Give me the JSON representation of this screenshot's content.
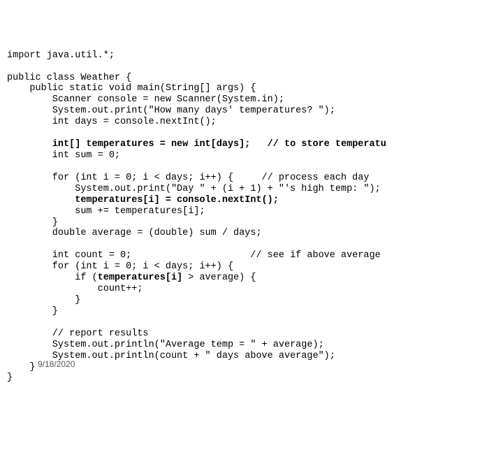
{
  "code": {
    "l01": "import java.util.*;",
    "l02": "",
    "l03": "public class Weather {",
    "l04": "    public static void main(String[] args) {",
    "l05": "        Scanner console = new Scanner(System.in);",
    "l06": "        System.out.print(\"How many days' temperatures? \");",
    "l07": "        int days = console.nextInt();",
    "l08": "",
    "l09a": "        ",
    "l09b": "int[] temperatures = new int[days];",
    "l09c": "   ",
    "l09d": "// to store temperatu",
    "l10": "        int sum = 0;",
    "l11": "",
    "l12": "        for (int i = 0; i < days; i++) {     // process each day",
    "l13": "            System.out.print(\"Day \" + (i + 1) + \"'s high temp: \");",
    "l14a": "            ",
    "l14b": "temperatures[i] = console.nextInt();",
    "l15": "            sum += temperatures[i];",
    "l16": "        }",
    "l17": "        double average = (double) sum / days;",
    "l18": "",
    "l19": "        int count = 0;                     // see if above average",
    "l20": "        for (int i = 0; i < days; i++) {",
    "l21a": "            if (",
    "l21b": "temperatures[i]",
    "l21c": " > average) {",
    "l22": "                count++;",
    "l23": "            }",
    "l24": "        }",
    "l25": "",
    "l26": "        // report results",
    "l27": "        System.out.println(\"Average temp = \" + average);",
    "l28": "        System.out.println(count + \" days above average\");",
    "l29": "    }",
    "l30": "}"
  },
  "footer": {
    "date": "9/18/2020"
  }
}
